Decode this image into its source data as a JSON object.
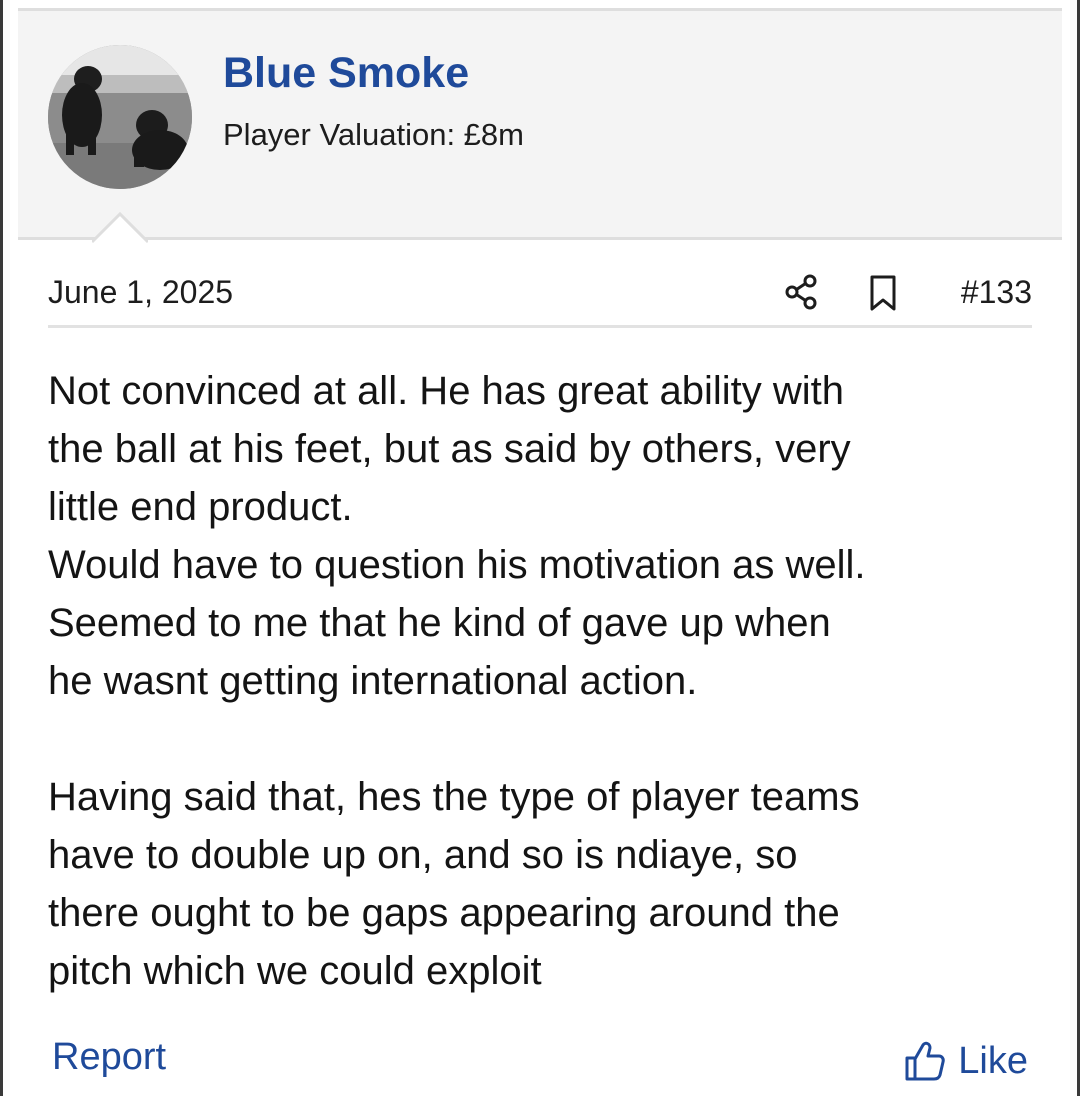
{
  "user": {
    "name": "Blue Smoke",
    "valuation": "Player Valuation: £8m"
  },
  "post": {
    "date": "June 1, 2025",
    "number": "#133",
    "lines_part1": [
      "Not convinced at all. He has great ability with",
      "the ball at his feet, but as said by others, very",
      "little end product.",
      "Would have to question his motivation as well.",
      "Seemed to me that he kind of gave up when",
      "he wasnt getting international action."
    ],
    "lines_part2": [
      "Having said that, hes the type of player teams",
      "have to double up on, and so is ndiaye, so",
      "there ought to be gaps appearing around the",
      "pitch which we could exploit"
    ]
  },
  "actions": {
    "report_label": "Report",
    "like_label": "Like",
    "share_icon": "share-icon",
    "bookmark_icon": "bookmark-icon",
    "like_icon": "thumbs-up-icon"
  },
  "colors": {
    "link": "#1f4a9a",
    "header_bg": "#f4f4f4"
  }
}
